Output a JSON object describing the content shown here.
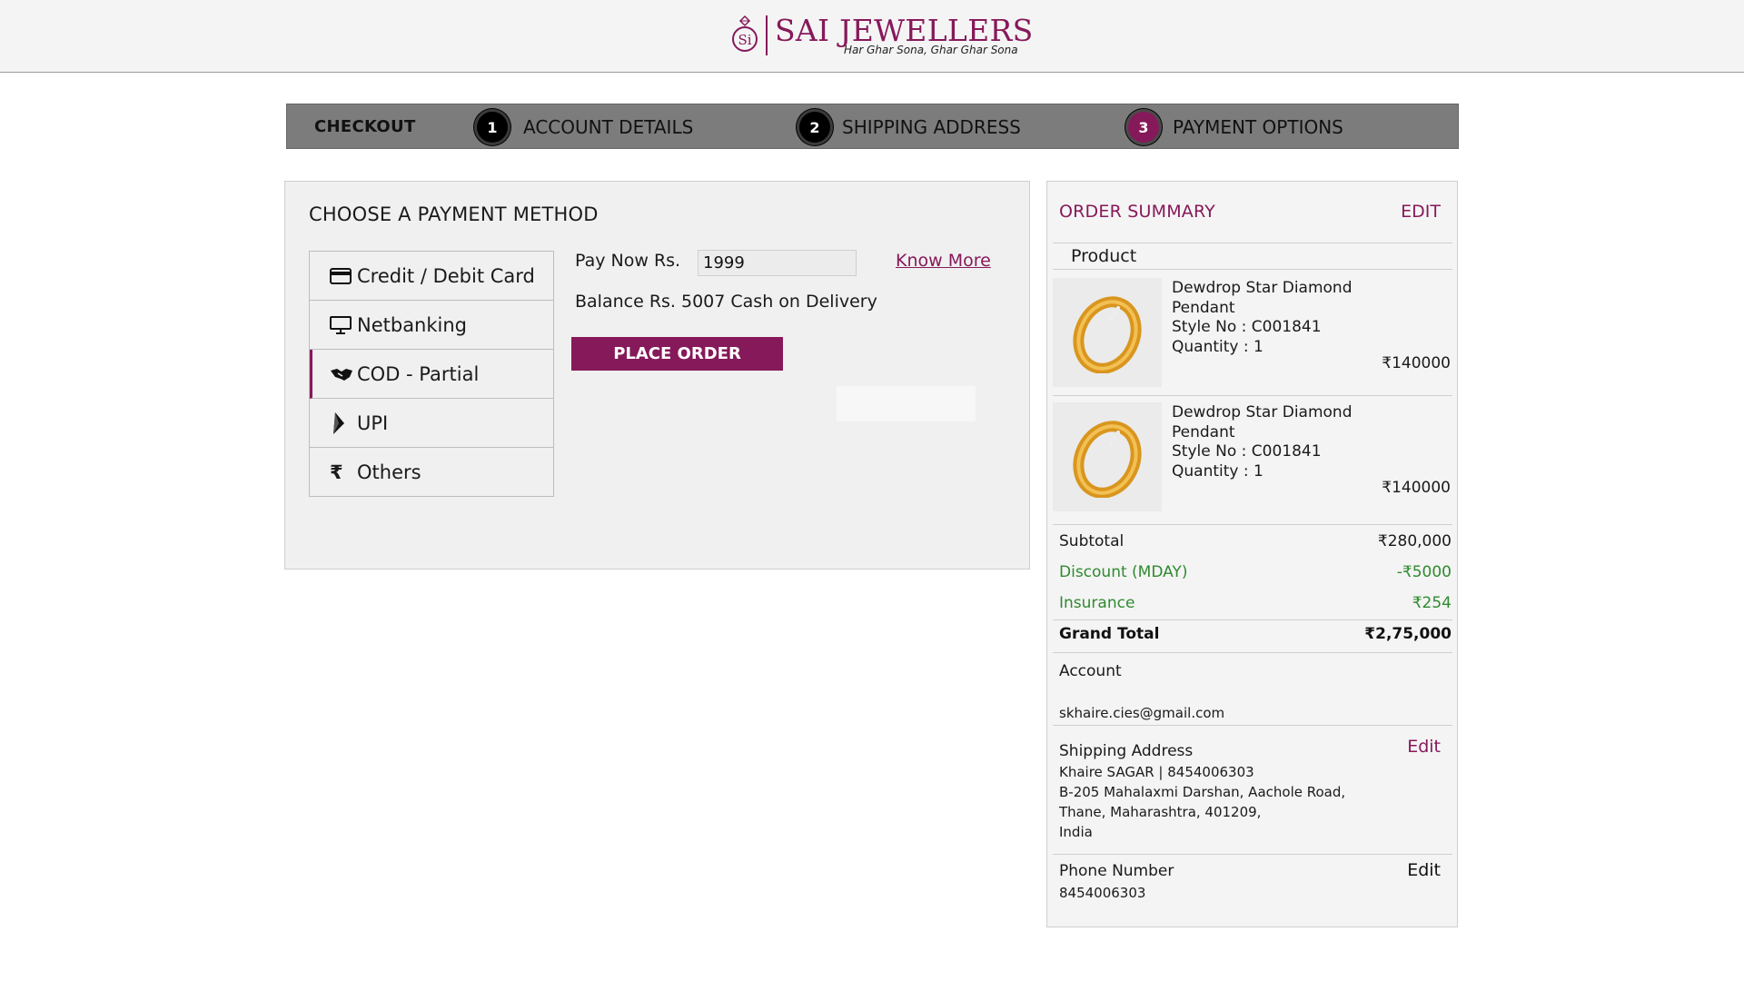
{
  "brand": {
    "name": "SAI JEWELLERS",
    "tagline": "Har Ghar Sona, Ghar Ghar Sona",
    "logo_icon": "ring-logo-icon",
    "brand_color": "#86195a"
  },
  "steps": {
    "title": "CHECKOUT",
    "items": [
      {
        "number": "1",
        "label": "ACCOUNT DETAILS",
        "active": false
      },
      {
        "number": "2",
        "label": "SHIPPING ADDRESS",
        "active": false
      },
      {
        "number": "3",
        "label": "PAYMENT OPTIONS",
        "active": true
      }
    ]
  },
  "payment": {
    "title": "CHOOSE A PAYMENT METHOD",
    "methods": [
      {
        "label": "Credit / Debit Card",
        "icon": "credit-card-icon"
      },
      {
        "label": "Netbanking",
        "icon": "monitor-icon"
      },
      {
        "label": "COD - Partial",
        "icon": "handshake-icon",
        "selected": true
      },
      {
        "label": "UPI",
        "icon": "upi-icon"
      },
      {
        "label": "Others",
        "icon": "rupee-icon"
      }
    ],
    "pay_now_label": "Pay Now Rs.",
    "pay_now_value": "1999",
    "know_more": "Know More",
    "balance_text": "Balance Rs. 5007 Cash on Delivery",
    "place_order": "PLACE ORDER"
  },
  "summary": {
    "title": "ORDER SUMMARY",
    "edit": "EDIT",
    "product_header": "Product",
    "items": [
      {
        "name": "Dewdrop Star Diamond Pendant",
        "style": "Style No : C001841",
        "quantity": "Quantity : 1",
        "price": "₹140000"
      },
      {
        "name": "Dewdrop Star Diamond Pendant",
        "style": "Style No : C001841",
        "quantity": "Quantity : 1",
        "price": "₹140000"
      }
    ],
    "subtotal_label": "Subtotal",
    "subtotal_value": "₹280,000",
    "discount_label": "Discount (MDAY)",
    "discount_value": "-₹5000",
    "insurance_label": "Insurance",
    "insurance_value": "₹254",
    "grand_total_label": "Grand Total",
    "grand_total_value": "₹2,75,000",
    "account_label": "Account",
    "account_email": "skhaire.cies@gmail.com",
    "shipping_label": "Shipping Address",
    "shipping_edit": "Edit",
    "shipping_lines": [
      "Khaire SAGAR | 8454006303",
      "B-205 Mahalaxmi Darshan, Aachole Road,",
      "Thane, Maharashtra, 401209,",
      "India"
    ],
    "phone_label": "Phone Number",
    "phone_edit": "Edit",
    "phone_value": "8454006303"
  }
}
